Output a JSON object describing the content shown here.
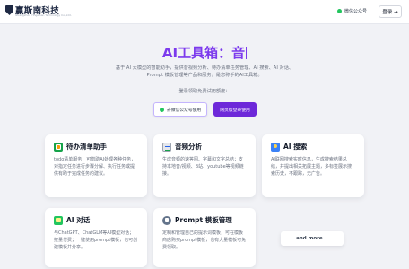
{
  "header": {
    "logo_text": "赢斯南科技",
    "logo_sub": "Guangzhou Yingsinan Technology Co.,Ltd.",
    "wechat_label": "微信公众号",
    "login_label": "登录 →"
  },
  "hero": {
    "title": "AI工具箱：音",
    "description": "基于 AI 大模型的智能助手，提供音视频分析、待办清单任务管理、AI 搜索、AI 对话、Prompt 模板管理等产品和服务，是您称手的AI工具箱。",
    "login_hint": "登录领取免费试用额度：",
    "wechat_button": "去微信公众号使用",
    "web_button": "网页版登录使用"
  },
  "cards": [
    {
      "title": "待办清单助手",
      "icon": "todo-list-icon",
      "desc": "todo清单服务，可借助AI处理各种任务，对指定任务进行步骤分解、执行任务或提供有助于完成任务的建议。"
    },
    {
      "title": "音频分析",
      "icon": "audio-analysis-icon",
      "desc": "生成音频的速答图、字幕和文字总结；支持本地音/视频、B站、youtube等视频链接。"
    },
    {
      "title": "AI 搜索",
      "icon": "ai-search-icon",
      "desc": "AI联网搜索实时信息，生成搜索结果总结，并提出相关拓展主题，多标签展示搜索历史，不跟踪，无广告。"
    },
    {
      "title": "AI 对话",
      "icon": "ai-chat-icon",
      "desc": "与ChatGPT、ChatGLM等AI模型对话；按量付费；一键使用prompt模板，也可创建模板并分享。"
    },
    {
      "title": "Prompt 模板管理",
      "icon": "prompt-template-icon",
      "desc": "定制和管理自己的提示词模板，可在模板商店购买prompt模板，也有大量模板可免费领取。"
    }
  ],
  "more_label": "and more..."
}
